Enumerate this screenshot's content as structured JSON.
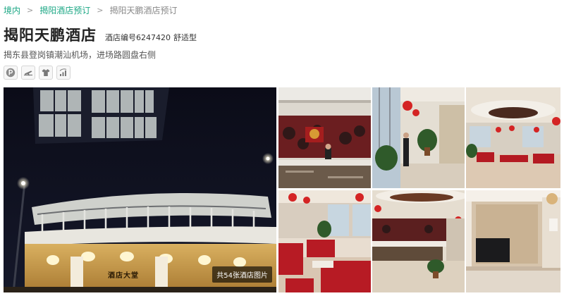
{
  "breadcrumb": {
    "items": [
      "境内",
      "揭阳酒店预订"
    ],
    "current": "揭阳天鹏酒店预订",
    "separator": ">"
  },
  "hotel": {
    "name": "揭阳天鹏酒店",
    "code": "酒店编号6247420",
    "grade": "舒适型",
    "address": "揭东县登岗镇潮汕机场，进场路圆盘右侧"
  },
  "amenities": [
    {
      "icon": "parking-icon"
    },
    {
      "icon": "airport-shuttle-icon"
    },
    {
      "icon": "laundry-icon"
    },
    {
      "icon": "wifi-icon"
    }
  ],
  "gallery": {
    "photo_count_label": "共54张酒店图片",
    "sign_text": "酒店大堂"
  },
  "colors": {
    "link": "#1ba784",
    "title": "#222222"
  }
}
